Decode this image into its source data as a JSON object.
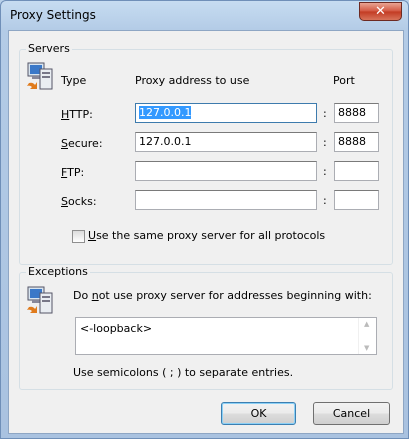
{
  "window": {
    "title": "Proxy Settings",
    "close_glyph": "✕"
  },
  "servers": {
    "group_title": "Servers",
    "headers": {
      "type": "Type",
      "address": "Proxy address to use",
      "port": "Port"
    },
    "rows": [
      {
        "accel": "H",
        "rest": "TTP:",
        "address": "127.0.0.1",
        "port": "8888"
      },
      {
        "accel": "S",
        "rest": "ecure:",
        "address": "127.0.0.1",
        "port": "8888"
      },
      {
        "accel": "F",
        "rest": "TP:",
        "address": "",
        "port": ""
      },
      {
        "accel": "S",
        "rest": "ocks:",
        "address": "",
        "port": ""
      }
    ],
    "colon": ":",
    "same_proxy": {
      "accel": "U",
      "rest": "se the same proxy server for all protocols",
      "checked": false
    }
  },
  "exceptions": {
    "group_title": "Exceptions",
    "desc_pre": "Do ",
    "desc_accel": "n",
    "desc_post": "ot use proxy server for addresses beginning with:",
    "value": "<-loopback>",
    "hint": "Use semicolons ( ; ) to separate entries."
  },
  "buttons": {
    "ok": "OK",
    "cancel": "Cancel"
  },
  "icons": {
    "servers": "network-computer-icon",
    "exceptions": "network-computer-icon"
  }
}
